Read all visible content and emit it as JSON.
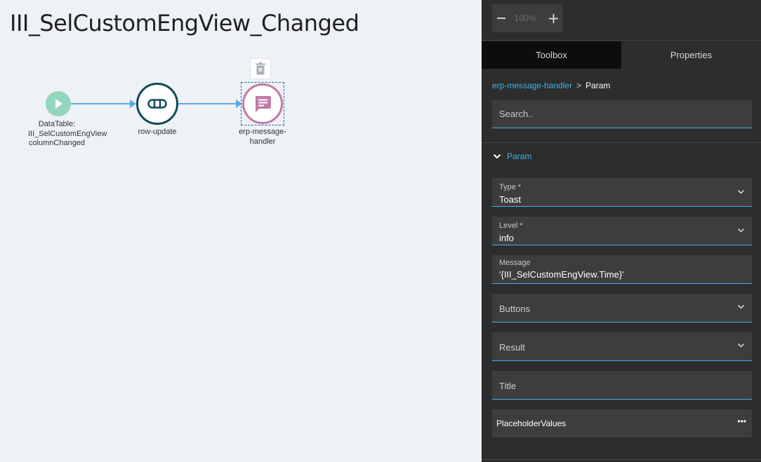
{
  "flow": {
    "title": "III_SelCustomEngView_Changed",
    "nodes": {
      "start": {
        "label": "DataTable: III_SelCustomEngView columnChanged"
      },
      "update": {
        "label": "row-update"
      },
      "message": {
        "label": "erp-message-handler"
      }
    }
  },
  "zoom": {
    "value": "100%",
    "minus_icon": "minus-icon",
    "plus_icon": "plus-icon"
  },
  "tabs": {
    "toolbox": "Toolbox",
    "properties": "Properties"
  },
  "breadcrumb": {
    "parent": "erp-message-handler",
    "separator": ">",
    "current": "Param"
  },
  "search": {
    "placeholder": "Search.."
  },
  "section": {
    "title": "Param"
  },
  "fields": {
    "type": {
      "label": "Type *",
      "value": "Toast"
    },
    "level": {
      "label": "Level *",
      "value": "info"
    },
    "message": {
      "label": "Message",
      "value": "'{III_SelCustomEngView.Time}'"
    },
    "buttons": {
      "label": "Buttons"
    },
    "result": {
      "label": "Result"
    },
    "title": {
      "label": "Title"
    },
    "placeholder_values": {
      "label": "PlaceholderValues",
      "more": "•••"
    }
  },
  "colors": {
    "accent": "#3fb3e8",
    "connector": "#5aa9e6",
    "start_node": "#93d6bd",
    "update_node": "#0e4a57",
    "message_node": "#c07aa5"
  }
}
